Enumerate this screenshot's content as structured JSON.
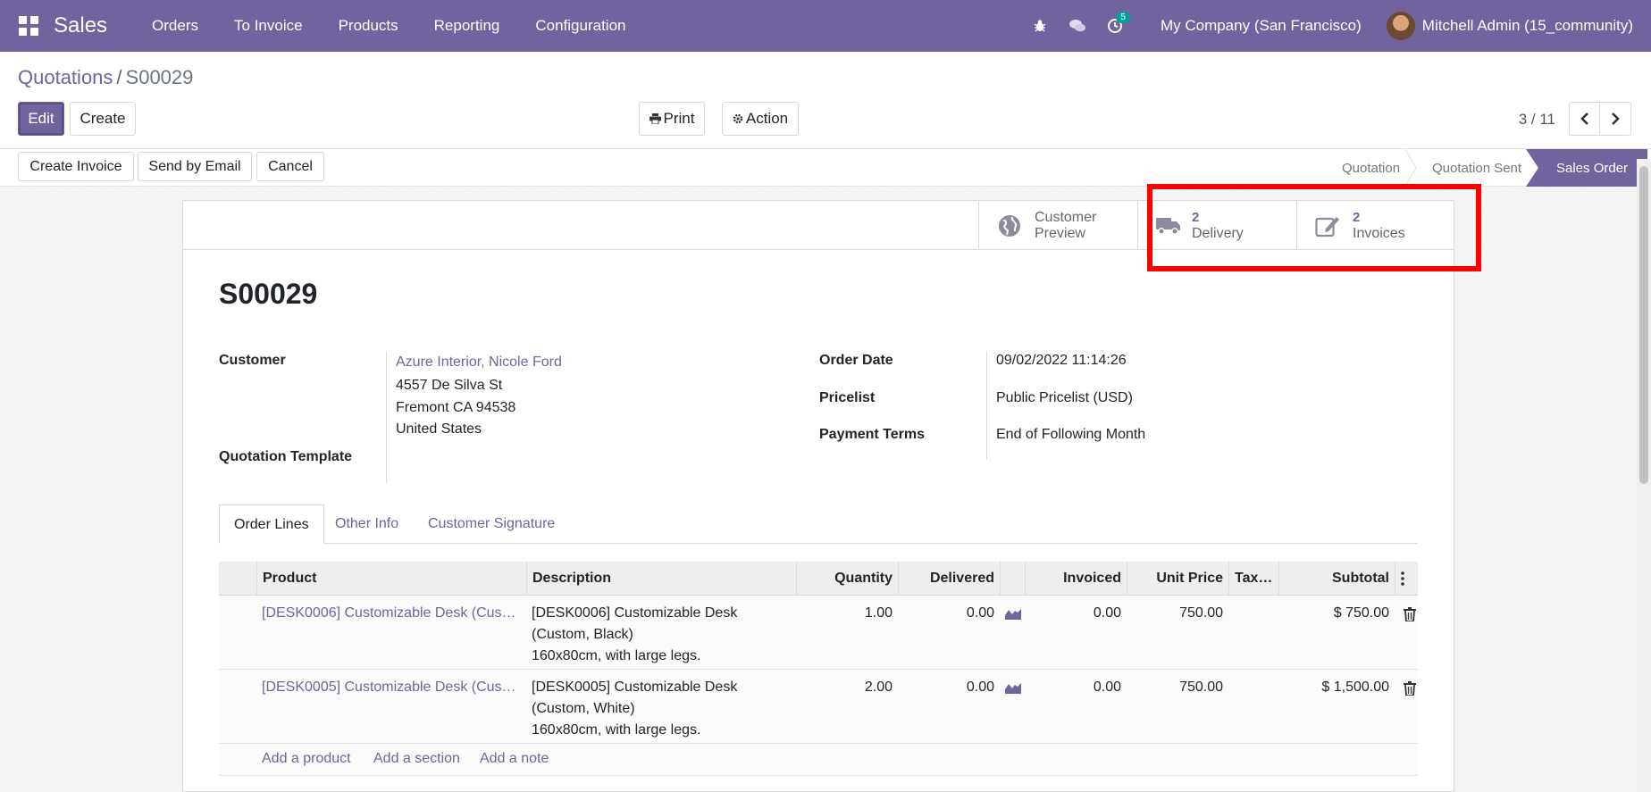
{
  "navbar": {
    "app_name": "Sales",
    "menu": [
      "Orders",
      "To Invoice",
      "Products",
      "Reporting",
      "Configuration"
    ],
    "activity_badge": "5",
    "company": "My Company (San Francisco)",
    "user": "Mitchell Admin (15_community)"
  },
  "breadcrumb": {
    "parent": "Quotations",
    "separator": "/",
    "current": "S00029"
  },
  "control": {
    "edit_label": "Edit",
    "create_label": "Create",
    "print_label": "Print",
    "action_label": "Action",
    "pager": "3 / 11"
  },
  "header_buttons": {
    "create_invoice": "Create Invoice",
    "send_email": "Send by Email",
    "cancel": "Cancel"
  },
  "statusbar": {
    "stages": [
      "Quotation",
      "Quotation Sent",
      "Sales Order"
    ],
    "active": "Sales Order"
  },
  "smart_buttons": {
    "preview": {
      "line1": "Customer",
      "line2": "Preview"
    },
    "delivery": {
      "count": "2",
      "label": "Delivery"
    },
    "invoices": {
      "count": "2",
      "label": "Invoices"
    }
  },
  "order": {
    "name": "S00029",
    "customer_label": "Customer",
    "customer_name": "Azure Interior, Nicole Ford",
    "address": [
      "4557 De Silva St",
      "Fremont CA 94538",
      "United States"
    ],
    "template_label": "Quotation Template",
    "order_date_label": "Order Date",
    "order_date": "09/02/2022 11:14:26",
    "pricelist_label": "Pricelist",
    "pricelist": "Public Pricelist (USD)",
    "payment_terms_label": "Payment Terms",
    "payment_terms": "End of Following Month"
  },
  "tabs": [
    "Order Lines",
    "Other Info",
    "Customer Signature"
  ],
  "table": {
    "headers": [
      "Product",
      "Description",
      "Quantity",
      "Delivered",
      "Invoiced",
      "Unit Price",
      "Tax…",
      "Subtotal"
    ],
    "rows": [
      {
        "product": "[DESK0006] Customizable Desk (Cus…",
        "desc": [
          "[DESK0006] Customizable Desk",
          "(Custom, Black)",
          "160x80cm, with large legs."
        ],
        "quantity": "1.00",
        "delivered": "0.00",
        "invoiced": "0.00",
        "unit_price": "750.00",
        "subtotal": "$ 750.00"
      },
      {
        "product": "[DESK0005] Customizable Desk (Cus…",
        "desc": [
          "[DESK0005] Customizable Desk",
          "(Custom, White)",
          "160x80cm, with large legs."
        ],
        "quantity": "2.00",
        "delivered": "0.00",
        "invoiced": "0.00",
        "unit_price": "750.00",
        "subtotal": "$ 1,500.00"
      }
    ],
    "add_product": "Add a product",
    "add_section": "Add a section",
    "add_note": "Add a note"
  },
  "colors": {
    "brand": "#71639e",
    "highlight": "#ff0000"
  }
}
